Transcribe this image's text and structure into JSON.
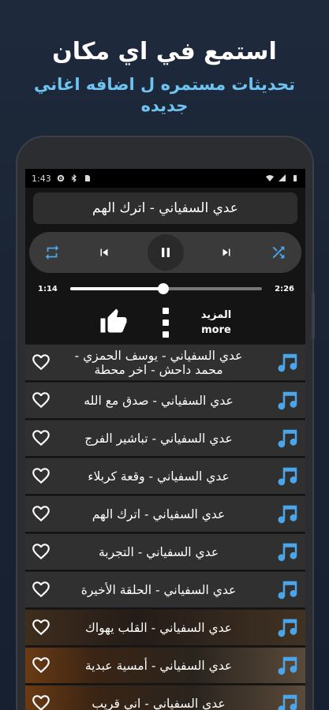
{
  "promo": {
    "title": "استمع في اي مكان",
    "subtitle": "تحديثات مستمره ل اضافه اغاني جديده"
  },
  "statusbar": {
    "time": "1:43"
  },
  "player": {
    "now_playing": "عدي السفياني - اترك الهم",
    "elapsed": "1:14",
    "duration": "2:26",
    "progress": 0.486
  },
  "actions": {
    "more_ar": "المزيد",
    "more_en": "more"
  },
  "songs": [
    {
      "title": "عدي السفياني - يوسف الحمزي - محمد داحش - اخر محطة"
    },
    {
      "title": "عدي السفياني - صدق مع الله"
    },
    {
      "title": "عدي السفياني - تباشير الفرج"
    },
    {
      "title": "عدي السفياني - وقعة كربلاء"
    },
    {
      "title": "عدي السفياني - اترك الهم"
    },
    {
      "title": "عدي السفياني - التجربة"
    },
    {
      "title": "عدي السفياني - الحلقة الأخيرة"
    },
    {
      "title": "عدي السفياني - القلب يهواك"
    },
    {
      "title": "عدي السفياني - أمسية عبدية"
    },
    {
      "title": "عدي السفياني - اني قريب"
    }
  ],
  "colors": {
    "accent_blue": "#4aa6e8",
    "subtitle_blue": "#6fc3f0",
    "row_bg": "#303030"
  }
}
